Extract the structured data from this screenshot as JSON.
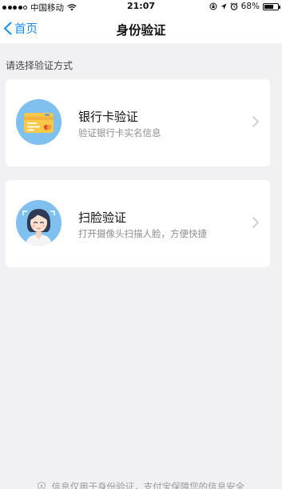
{
  "status_bar": {
    "carrier": "中国移动",
    "time": "21:07",
    "battery": "68%",
    "battery_level": 0.68,
    "icons": [
      "signal-icon",
      "wifi-icon",
      "orientation-lock-icon",
      "location-icon",
      "alarm-icon",
      "battery-icon"
    ]
  },
  "nav": {
    "back_label": "首页",
    "title": "身份验证"
  },
  "hint": "请选择验证方式",
  "options": [
    {
      "title": "银行卡验证",
      "subtitle": "验证银行卡实名信息",
      "icon": "bank-card-icon"
    },
    {
      "title": "扫脸验证",
      "subtitle": "打开摄像头扫描人脸，方便快捷",
      "icon": "face-scan-icon"
    }
  ],
  "footer": "信息仅用于身份验证，支付宝保障您的信息安全",
  "colors": {
    "accent": "#1a8cf0",
    "background": "#f1f1f3",
    "icon_circle": "#7fc0ef"
  }
}
